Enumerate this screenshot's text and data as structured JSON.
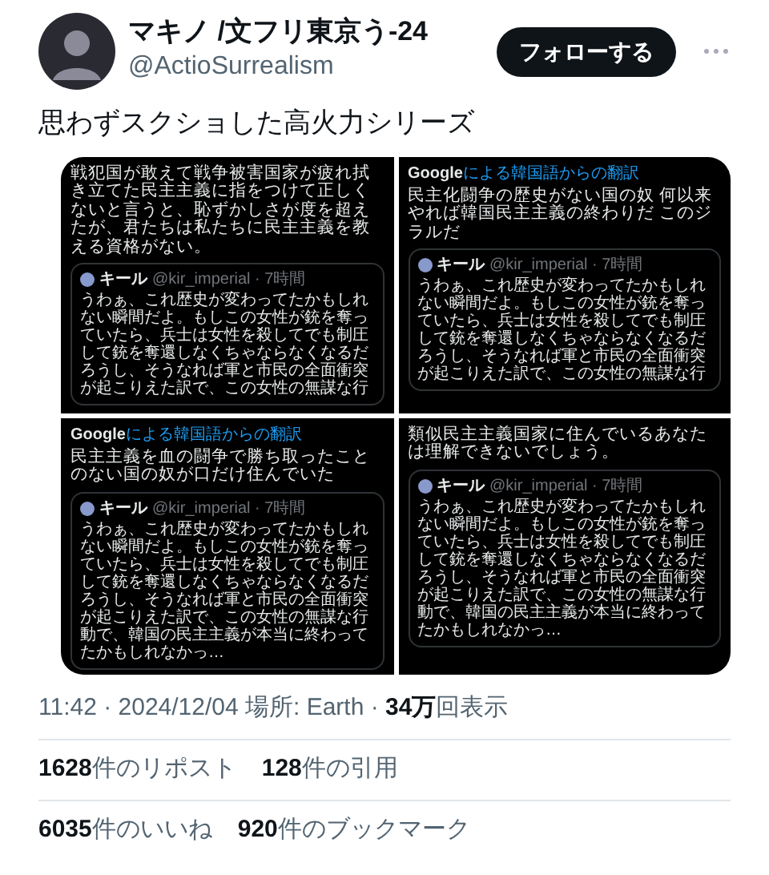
{
  "author": {
    "name": "マキノ /文フリ東京う-24",
    "handle": "@ActioSurrealism"
  },
  "follow_button": "フォローする",
  "tweet_text": "思わずスクショした高火力シリーズ",
  "media": [
    {
      "text": "戦犯国が敢えて戦争被害国家が疲れ拭き立てた民主主義に指をつけて正しくないと言うと、恥ずかしさが度を超えたが、君たちは私たちに民主主義を教える資格がない。",
      "quote": {
        "name": "キール",
        "handle": "@kir_imperial · 7時間",
        "text": "うわぁ、これ歴史が変わってたかもしれない瞬間だよ。もしこの女性が銃を奪っていたら、兵士は女性を殺してでも制圧して銃を奪還しなくちゃならなくなるだろうし、そうなれば軍と市民の全面衝突が起こりえた訳で、この女性の無謀な行"
      }
    },
    {
      "translation": {
        "source": "Google",
        "label": "による韓国語からの翻訳"
      },
      "text": "民主化闘争の歴史がない国の奴 何以来やれば韓国民主主義の終わりだ このジラルだ",
      "quote": {
        "name": "キール",
        "handle": "@kir_imperial · 7時間",
        "text": "うわぁ、これ歴史が変わってたかもしれない瞬間だよ。もしこの女性が銃を奪っていたら、兵士は女性を殺してでも制圧して銃を奪還しなくちゃならなくなるだろうし、そうなれば軍と市民の全面衝突が起こりえた訳で、この女性の無謀な行"
      }
    },
    {
      "translation": {
        "source": "Google",
        "label": "による韓国語からの翻訳"
      },
      "text": "民主主義を血の闘争で勝ち取ったことのない国の奴が口だけ住んでいた",
      "quote": {
        "name": "キール",
        "handle": "@kir_imperial · 7時間",
        "text": "うわぁ、これ歴史が変わってたかもしれない瞬間だよ。もしこの女性が銃を奪っていたら、兵士は女性を殺してでも制圧して銃を奪還しなくちゃならなくなるだろうし、そうなれば軍と市民の全面衝突が起こりえた訳で、この女性の無謀な行動で、韓国の民主主義が本当に終わってたかもしれなかっ…"
      }
    },
    {
      "text": "類似民主主義国家に住んでいるあなたは理解できないでしょう。",
      "quote": {
        "name": "キール",
        "handle": "@kir_imperial · 7時間",
        "text": "うわぁ、これ歴史が変わってたかもしれない瞬間だよ。もしこの女性が銃を奪っていたら、兵士は女性を殺してでも制圧して銃を奪還しなくちゃならなくなるだろうし、そうなれば軍と市民の全面衝突が起こりえた訳で、この女性の無謀な行動で、韓国の民主主義が本当に終わってたかもしれなかっ…"
      }
    }
  ],
  "meta": "11:42 · 2024/12/04 場所: Earth · **34万**回表示",
  "stats": [
    [
      "**1628**件のリポスト",
      "**128**件の引用"
    ],
    [
      "**6035**件のいいね",
      "**920**件のブックマーク"
    ]
  ]
}
